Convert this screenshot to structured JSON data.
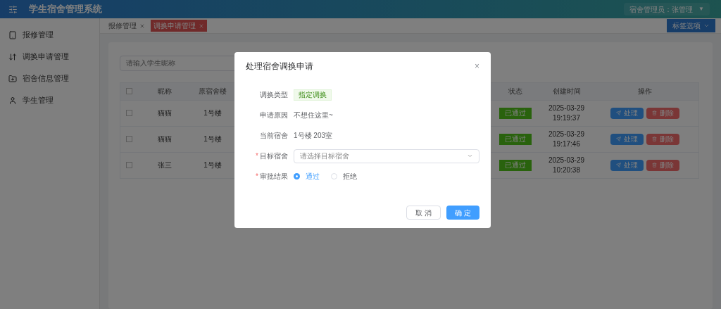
{
  "header": {
    "title": "学生宿舍管理系统",
    "user": "宿舍管理员：张管理",
    "caret": "▼"
  },
  "sidebar": {
    "items": [
      {
        "label": "报修管理"
      },
      {
        "label": "调换申请管理"
      },
      {
        "label": "宿舍信息管理"
      },
      {
        "label": "学生管理"
      }
    ]
  },
  "tabs": [
    {
      "label": "报修管理",
      "selected": false
    },
    {
      "label": "调换申请管理",
      "selected": true
    }
  ],
  "tab_options": "标签选项",
  "search": {
    "placeholder": "请输入学生昵称"
  },
  "table": {
    "header_checked": false,
    "columns": [
      "昵称",
      "原宿舍楼",
      "状态",
      "创建时间",
      "操作"
    ],
    "rows": [
      {
        "checked": false,
        "name": "猫猫",
        "building": "1号楼",
        "status": "已通过",
        "time": "2025-03-29 19:19:37",
        "actions": [
          "处理",
          "删除"
        ]
      },
      {
        "checked": false,
        "name": "猫猫",
        "building": "1号楼",
        "status": "已通过",
        "time": "2025-03-29 19:17:46",
        "actions": [
          "处理",
          "删除"
        ]
      },
      {
        "checked": false,
        "name": "张三",
        "building": "1号楼",
        "status": "已通过",
        "time": "2025-03-29 10:20:38",
        "actions": [
          "处理",
          "删除"
        ]
      }
    ]
  },
  "dialog": {
    "title": "处理宿舍调换申请",
    "close": "×",
    "required_mark": "*",
    "fields": [
      {
        "kind": "tag",
        "label": "调换类型",
        "value": "指定调换",
        "required": false
      },
      {
        "kind": "text",
        "label": "申请原因",
        "value": "不想住这里~",
        "required": false
      },
      {
        "kind": "text",
        "label": "当前宿舍",
        "value": "1号楼 203室",
        "required": false
      },
      {
        "kind": "select",
        "label": "目标宿舍",
        "placeholder": "请选择目标宿舍",
        "required": true
      },
      {
        "kind": "radio",
        "label": "审批结果",
        "required": true,
        "options": [
          {
            "label": "通过",
            "selected": true
          },
          {
            "label": "拒绝",
            "selected": false
          }
        ]
      }
    ],
    "buttons": [
      {
        "label": "取 消",
        "primary": false
      },
      {
        "label": "确 定",
        "primary": true
      }
    ]
  }
}
